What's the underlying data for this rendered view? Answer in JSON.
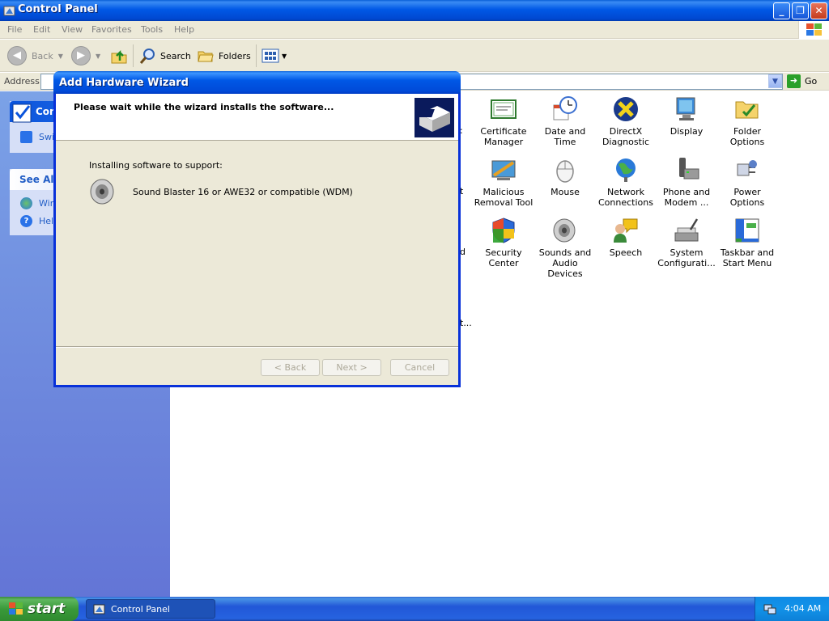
{
  "window": {
    "title": "Control Panel",
    "buttons": {
      "minimize": "_",
      "maximize": "❐",
      "close": "✕"
    }
  },
  "menubar": [
    "File",
    "Edit",
    "View",
    "Favorites",
    "Tools",
    "Help"
  ],
  "toolbar": {
    "back": "Back",
    "search": "Search",
    "folders": "Folders"
  },
  "address": {
    "label": "Address",
    "go": "Go"
  },
  "left_pane": {
    "panel_title": "Con",
    "panel_item": "Swi",
    "see_also_title": "See Als",
    "see_also_items": [
      "Win",
      "Help"
    ]
  },
  "content": {
    "partial_labels": [
      ":",
      "t",
      "d",
      "t...",
      "t..."
    ],
    "items": [
      {
        "label1": "Certificate",
        "label2": "Manager",
        "icon": "certificate-icon"
      },
      {
        "label1": "Date and Time",
        "label2": "",
        "icon": "date-time-icon"
      },
      {
        "label1": "DirectX",
        "label2": "Diagnostic",
        "icon": "directx-icon"
      },
      {
        "label1": "Display",
        "label2": "",
        "icon": "display-icon"
      },
      {
        "label1": "Folder Options",
        "label2": "",
        "icon": "folder-options-icon"
      },
      {
        "label1": "Malicious",
        "label2": "Removal Tool",
        "icon": "malicious-removal-icon"
      },
      {
        "label1": "Mouse",
        "label2": "",
        "icon": "mouse-icon"
      },
      {
        "label1": "Network",
        "label2": "Connections",
        "icon": "network-icon"
      },
      {
        "label1": "Phone and",
        "label2": "Modem ...",
        "icon": "phone-modem-icon"
      },
      {
        "label1": "Power Options",
        "label2": "",
        "icon": "power-options-icon"
      },
      {
        "label1": "Security",
        "label2": "Center",
        "icon": "security-center-icon"
      },
      {
        "label1": "Sounds and",
        "label2": "Audio Devices",
        "icon": "sounds-icon"
      },
      {
        "label1": "Speech",
        "label2": "",
        "icon": "speech-icon"
      },
      {
        "label1": "System",
        "label2": "Configurati...",
        "icon": "system-config-icon"
      },
      {
        "label1": "Taskbar and",
        "label2": "Start Menu",
        "icon": "taskbar-icon"
      }
    ]
  },
  "wizard": {
    "title": "Add Hardware Wizard",
    "heading": "Please wait while the wizard installs the software...",
    "body_label": "Installing software to support:",
    "device": "Sound Blaster 16 or AWE32 or compatible (WDM)",
    "buttons": {
      "back": "< Back",
      "next": "Next >",
      "cancel": "Cancel"
    }
  },
  "taskbar": {
    "start": "start",
    "task": "Control Panel",
    "clock": "4:04 AM"
  },
  "colors": {
    "xp_blue": "#0058e6",
    "start_green": "#3a9a3a",
    "task_link": "#215dc6"
  }
}
